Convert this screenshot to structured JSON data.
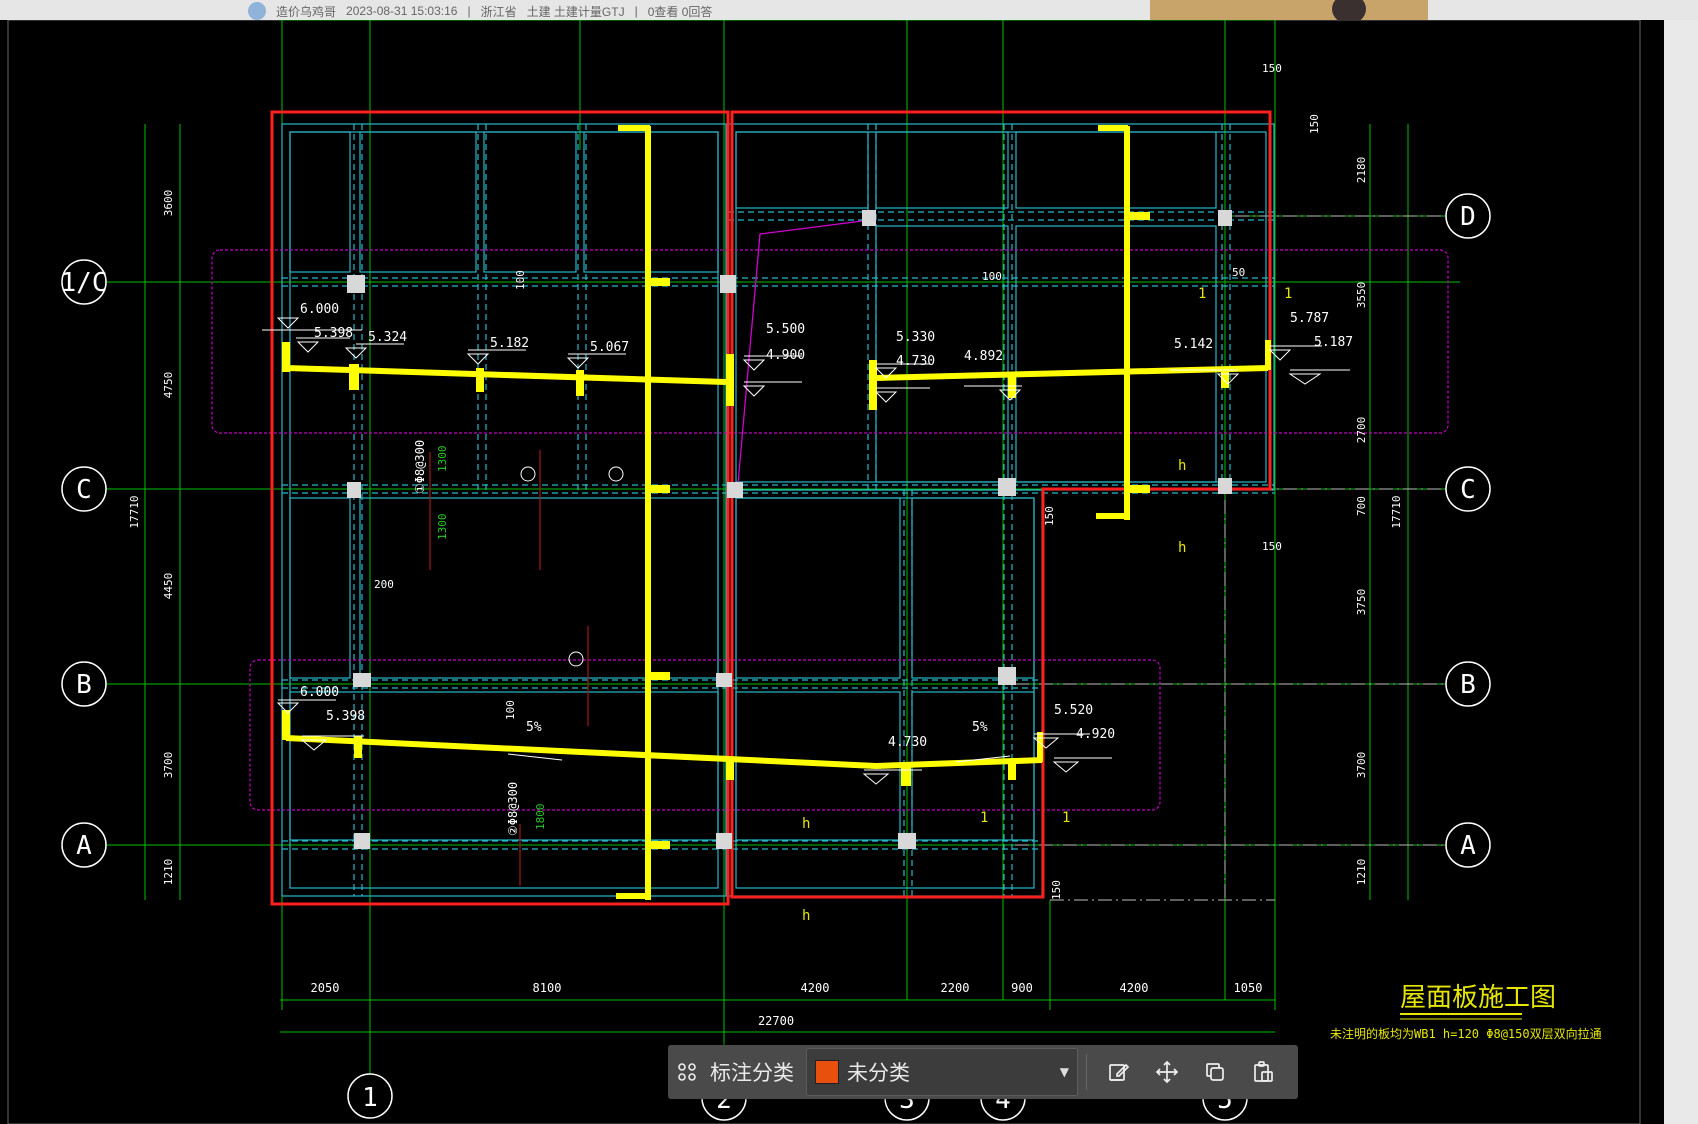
{
  "post": {
    "author": "造价乌鸡哥",
    "datetime": "2023-08-31 15:03:16",
    "separator": "|",
    "region": "浙江省",
    "tags": "土建 土建计量GTJ",
    "stats": "0查看  0回答"
  },
  "drawing": {
    "title": "屋面板施工图",
    "note": "未注明的板均为WB1 h=120 Φ8@150双层双向拉通",
    "axes": {
      "a1c": "1/C",
      "c": "C",
      "b": "B",
      "a": "A",
      "d": "D",
      "n1": "1",
      "n2": "2",
      "n3": "3",
      "n4": "4",
      "n5": "5"
    },
    "dims_left": [
      "3600",
      "4750",
      "4450",
      "3700",
      "1210"
    ],
    "dim_left_total": "17710",
    "dims_right": [
      "2180",
      "3550",
      "2700",
      "700",
      "3750",
      "3700",
      "1210"
    ],
    "dim_right_total": "17710",
    "dims_bottom": [
      "2050",
      "8100",
      "4200",
      "2200",
      "900",
      "4200",
      "1050"
    ],
    "dim_bottom_total": "22700",
    "small_dims": [
      "150",
      "150",
      "150",
      "150",
      "150",
      "100",
      "100",
      "200",
      "100",
      "50"
    ],
    "elevations": [
      "6.000",
      "5.398",
      "5.324",
      "5.182",
      "5.067",
      "5.500",
      "4.900",
      "5.330",
      "4.730",
      "4.892",
      "5.142",
      "5.787",
      "5.187",
      "6.000",
      "5.398",
      "4.730",
      "5.520",
      "4.920"
    ],
    "slopes": [
      "5%",
      "5%"
    ],
    "rebar_labels": [
      "①Φ8@300",
      "1300",
      "1300",
      "②Φ8@300",
      "1800"
    ],
    "slab_marks": [
      "h",
      "h",
      "h",
      "h",
      "1",
      "1",
      "1",
      "1"
    ]
  },
  "toolbar": {
    "category_label": "标注分类",
    "category_value": "未分类",
    "swatch_color": "#e8500e"
  },
  "colors": {
    "grid": "#00c000",
    "beam": "#29b7c9",
    "path": "#ffff00",
    "region": "#ff2020",
    "highlight": "#d000d0"
  }
}
